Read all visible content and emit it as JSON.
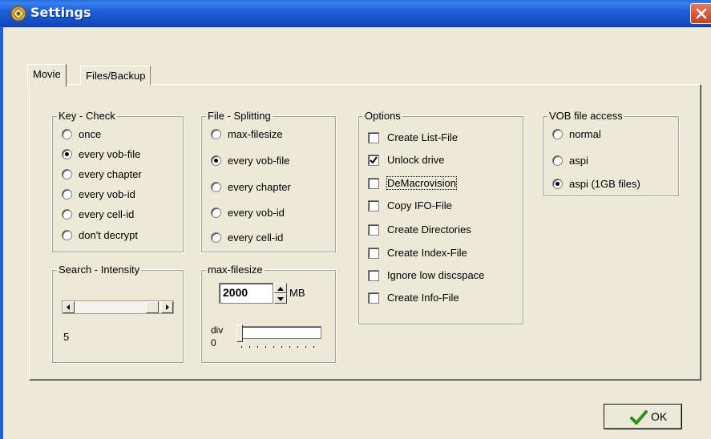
{
  "window": {
    "title": "Settings"
  },
  "tabs": [
    {
      "label": "Movie",
      "selected": true
    },
    {
      "label": "Files/Backup",
      "selected": false
    }
  ],
  "key_check": {
    "label": "Key - Check",
    "options": [
      "once",
      "every vob-file",
      "every chapter",
      "every vob-id",
      "every cell-id",
      "don't decrypt"
    ],
    "selected": "every vob-file"
  },
  "file_splitting": {
    "label": "File - Splitting",
    "options": [
      "max-filesize",
      "every vob-file",
      "every chapter",
      "every vob-id",
      "every cell-id"
    ],
    "selected": "every vob-file"
  },
  "options": {
    "label": "Options",
    "items": [
      {
        "label": "Create List-File",
        "checked": false
      },
      {
        "label": "Unlock drive",
        "checked": true
      },
      {
        "label": "DeMacrovision",
        "checked": false
      },
      {
        "label": "Copy IFO-File",
        "checked": false
      },
      {
        "label": "Create Directories",
        "checked": false
      },
      {
        "label": "Create Index-File",
        "checked": false
      },
      {
        "label": "Ignore low discspace",
        "checked": false
      },
      {
        "label": "Create Info-File",
        "checked": false
      }
    ]
  },
  "vob_access": {
    "label": "VOB file access",
    "options": [
      "normal",
      "aspi",
      "aspi (1GB files)"
    ],
    "selected": "aspi (1GB files)"
  },
  "search_intensity": {
    "label": "Search - Intensity",
    "value": "5"
  },
  "max_filesize": {
    "label": "max-filesize",
    "value": "2000",
    "unit": "MB",
    "div_label": "div",
    "div_value": "0"
  },
  "ok_button": {
    "label": "OK"
  }
}
